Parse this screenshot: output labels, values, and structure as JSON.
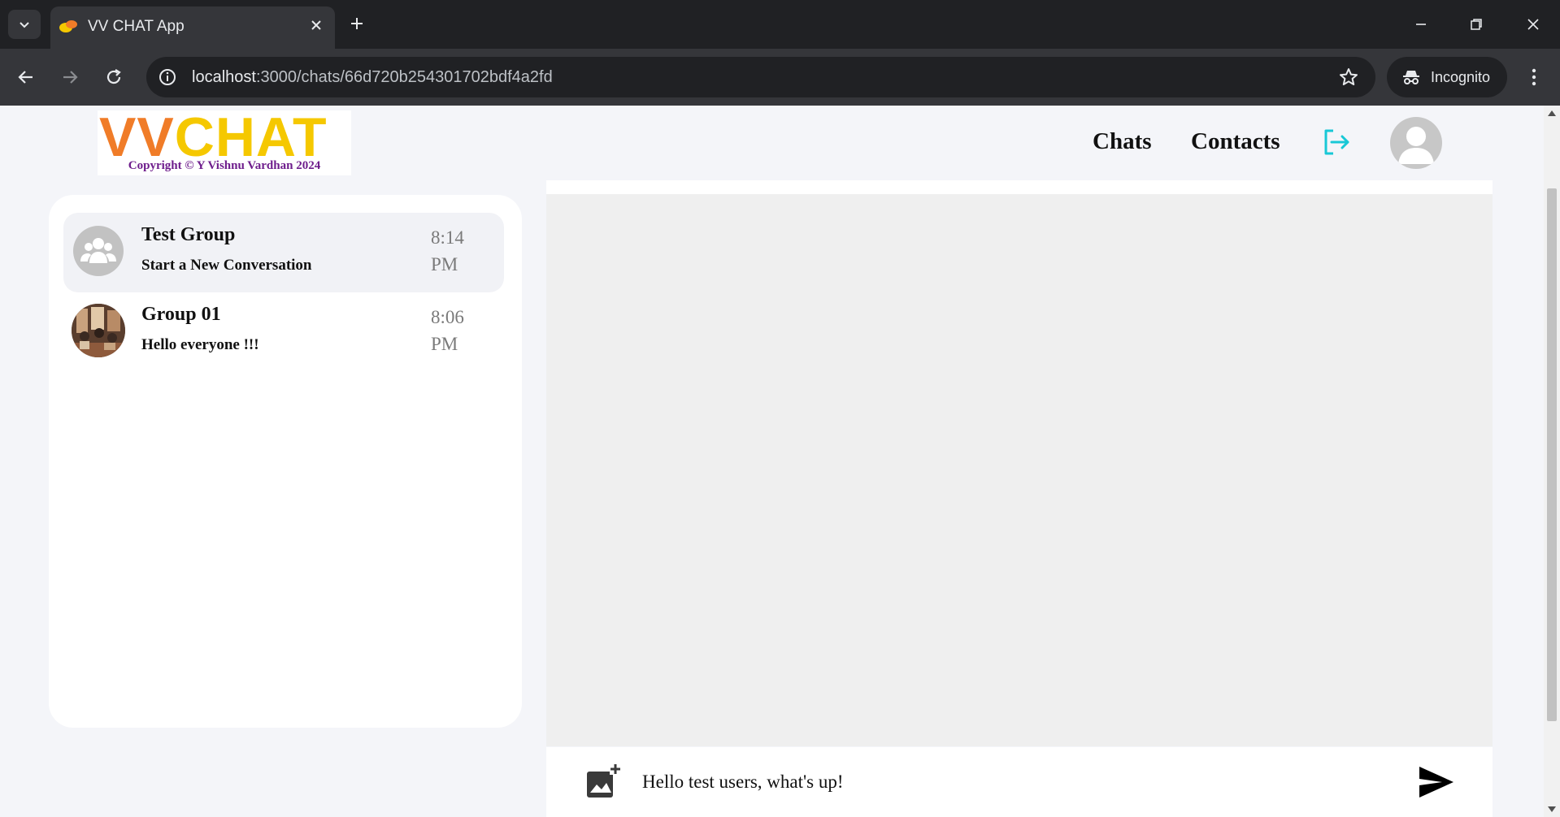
{
  "browser": {
    "tab_title": "VV CHAT App",
    "url_host": "localhost",
    "url_path": ":3000/chats/66d720b254301702bdf4a2fd",
    "incognito_label": "Incognito"
  },
  "app": {
    "logo_vv": "VV",
    "logo_chat": "CHAT",
    "logo_copyright": "Copyright © Y Vishnu Vardhan 2024",
    "nav": {
      "chats": "Chats",
      "contacts": "Contacts"
    }
  },
  "chats": [
    {
      "name": "Test Group",
      "last_message": "Start a New Conversation",
      "time": "8:14 PM",
      "active": true,
      "avatar": "group-placeholder"
    },
    {
      "name": "Group 01",
      "last_message": "Hello everyone !!!",
      "time": "8:06 PM",
      "active": false,
      "avatar": "group-photo"
    }
  ],
  "composer": {
    "value": "Hello test users, what's up!"
  },
  "colors": {
    "logout_icon": "#18c8d6",
    "logo_vv": "#f07c28",
    "logo_chat": "#f5c800",
    "copyright": "#6e1d8c"
  }
}
